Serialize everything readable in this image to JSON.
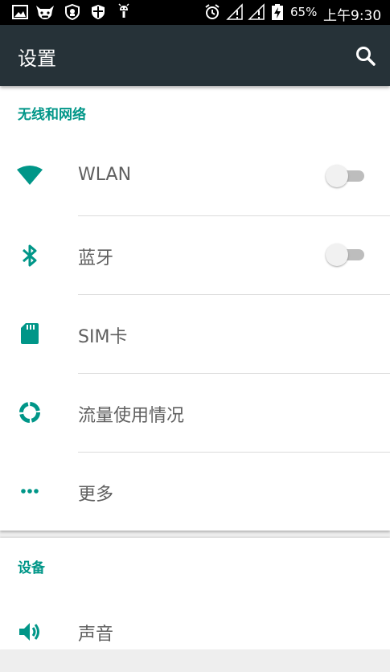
{
  "status_bar": {
    "battery": "65%",
    "time": "上午9:30",
    "icons": [
      "image-icon",
      "cow-icon",
      "shield-icon",
      "shield-icon",
      "android-icon",
      "alarm-icon",
      "signal-icon",
      "signal-icon",
      "battery-charging-icon"
    ]
  },
  "app_bar": {
    "title": "设置",
    "search_icon": "search-icon"
  },
  "sections": {
    "wireless": {
      "header": "无线和网络",
      "items": [
        {
          "label": "WLAN",
          "icon": "wifi-icon",
          "toggle": "off"
        },
        {
          "label": "蓝牙",
          "icon": "bluetooth-icon",
          "toggle": "off"
        },
        {
          "label": "SIM卡",
          "icon": "sim-card-icon"
        },
        {
          "label": "流量使用情况",
          "icon": "data-usage-icon"
        },
        {
          "label": "更多",
          "icon": "more-icon"
        }
      ]
    },
    "device": {
      "header": "设备",
      "items": [
        {
          "label": "声音",
          "icon": "volume-icon"
        }
      ]
    }
  },
  "colors": {
    "accent": "#009688",
    "app_bar": "#263238",
    "status_bar": "#000000",
    "background": "#eeeeee"
  }
}
